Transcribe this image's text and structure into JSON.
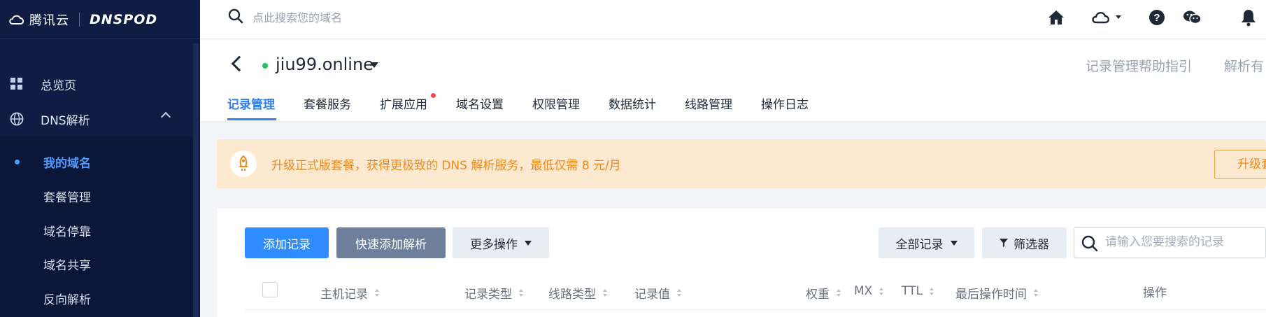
{
  "brand": {
    "name": "腾讯云",
    "product": "DNSPOD"
  },
  "sidebar": {
    "items": [
      {
        "label": "总览页",
        "icon": "grid-icon"
      },
      {
        "label": "DNS解析",
        "icon": "globe-icon",
        "expanded": true
      }
    ],
    "subitems": [
      {
        "label": "我的域名",
        "active": true
      },
      {
        "label": "套餐管理"
      },
      {
        "label": "域名停靠"
      },
      {
        "label": "域名共享"
      },
      {
        "label": "反向解析"
      }
    ]
  },
  "topbar": {
    "search_placeholder": "点此搜索您的域名",
    "icons": [
      "home-icon",
      "cloud-icon",
      "help-icon",
      "wechat-icon",
      "bell-icon"
    ]
  },
  "domain": {
    "name": "jiu99.online",
    "status": "active",
    "help_links": [
      "记录管理帮助指引",
      "解析有"
    ]
  },
  "tabs": [
    {
      "label": "记录管理",
      "active": true
    },
    {
      "label": "套餐服务"
    },
    {
      "label": "扩展应用",
      "badge": true
    },
    {
      "label": "域名设置"
    },
    {
      "label": "权限管理"
    },
    {
      "label": "数据统计"
    },
    {
      "label": "线路管理"
    },
    {
      "label": "操作日志"
    }
  ],
  "banner": {
    "text": "升级正式版套餐，获得更极致的 DNS 解析服务，最低仅需 8 元/月",
    "button": "升级套餐"
  },
  "toolbar": {
    "add_record": "添加记录",
    "quick_add": "快速添加解析",
    "more_actions": "更多操作",
    "all_records": "全部记录",
    "filter": "筛选器",
    "search_placeholder": "请输入您要搜索的记录"
  },
  "table": {
    "headers": [
      "主机记录",
      "记录类型",
      "线路类型",
      "记录值",
      "权重",
      "MX",
      "TTL",
      "最后操作时间",
      "操作"
    ]
  },
  "colors": {
    "sidebar_bg": "#0f1d45",
    "accent": "#2f80ed",
    "banner_bg": "#fde9cf",
    "banner_text": "#f08a1c",
    "status_green": "#22c55e"
  }
}
